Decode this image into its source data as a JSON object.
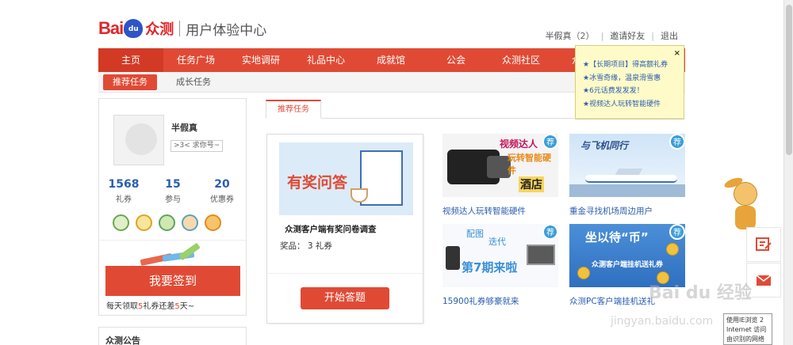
{
  "header": {
    "logo_bai": "Bai",
    "logo_du": "du",
    "logo_zhongce": "众测",
    "subtitle": "用户体验中心",
    "user_name": "半假真",
    "message_count": "（2）",
    "invite_label": "邀请好友",
    "logout_label": "退出"
  },
  "nav": {
    "items": [
      {
        "label": "主页"
      },
      {
        "label": "任务广场"
      },
      {
        "label": "实地调研"
      },
      {
        "label": "礼品中心"
      },
      {
        "label": "成就馆"
      },
      {
        "label": "公会"
      },
      {
        "label": "众测社区"
      },
      {
        "label": "众测攻"
      }
    ],
    "sub": {
      "active": "推荐任务",
      "other": "成长任务"
    }
  },
  "popup": {
    "lines": [
      "★【长期项目】得高额礼券",
      "★冰雪奇缘，温泉滑雪惠",
      "★6元话费发发发！",
      "★视频达人玩转智能硬件"
    ],
    "close": "×"
  },
  "profile": {
    "name": "半假真",
    "level": ">3< 求你号~",
    "stats": [
      {
        "value": "1568",
        "label": "礼券"
      },
      {
        "value": "15",
        "label": "参与"
      },
      {
        "value": "20",
        "label": "优惠券"
      }
    ],
    "sign_button": "我要签到",
    "sign_tip_pre": "每天领取",
    "sign_tip_num": "5",
    "sign_tip_mid": "礼券还差",
    "sign_tip_num2": "5",
    "sign_tip_post": "天~"
  },
  "notice": {
    "title": "众测公告"
  },
  "content": {
    "tab": "推荐任务",
    "featured": {
      "image_text": "有奖问答",
      "title": "众测客户端有奖问卷调查",
      "prize": "奖品： 3 礼券",
      "button": "开始答题"
    },
    "cards": [
      {
        "caption": "视频达人玩转智能硬件",
        "badge": "荐",
        "img_t1": "视频达人",
        "img_t2": "玩转智能硬件",
        "img_t3": "酒店"
      },
      {
        "caption": "重金寻找机场周边用户",
        "badge": "荐",
        "img_t1": "与飞机同行"
      },
      {
        "caption": "15900礼券够豪就来",
        "badge": "荐",
        "img_t1": "配图",
        "img_t2": "迭代",
        "img_t3": "第7期来啦"
      },
      {
        "caption": "众测PC客户端挂机送礼",
        "badge": "荐",
        "img_t1": "坐以待“币”",
        "img_t2": "众测客户端挂机送礼券"
      }
    ]
  },
  "overlay": {
    "watermark": "Bai du 经验",
    "watermark_url": "jingyan.baidu.com",
    "ie_tip": "使用IE浏览 2 Internet 访问 由识别的网络"
  }
}
